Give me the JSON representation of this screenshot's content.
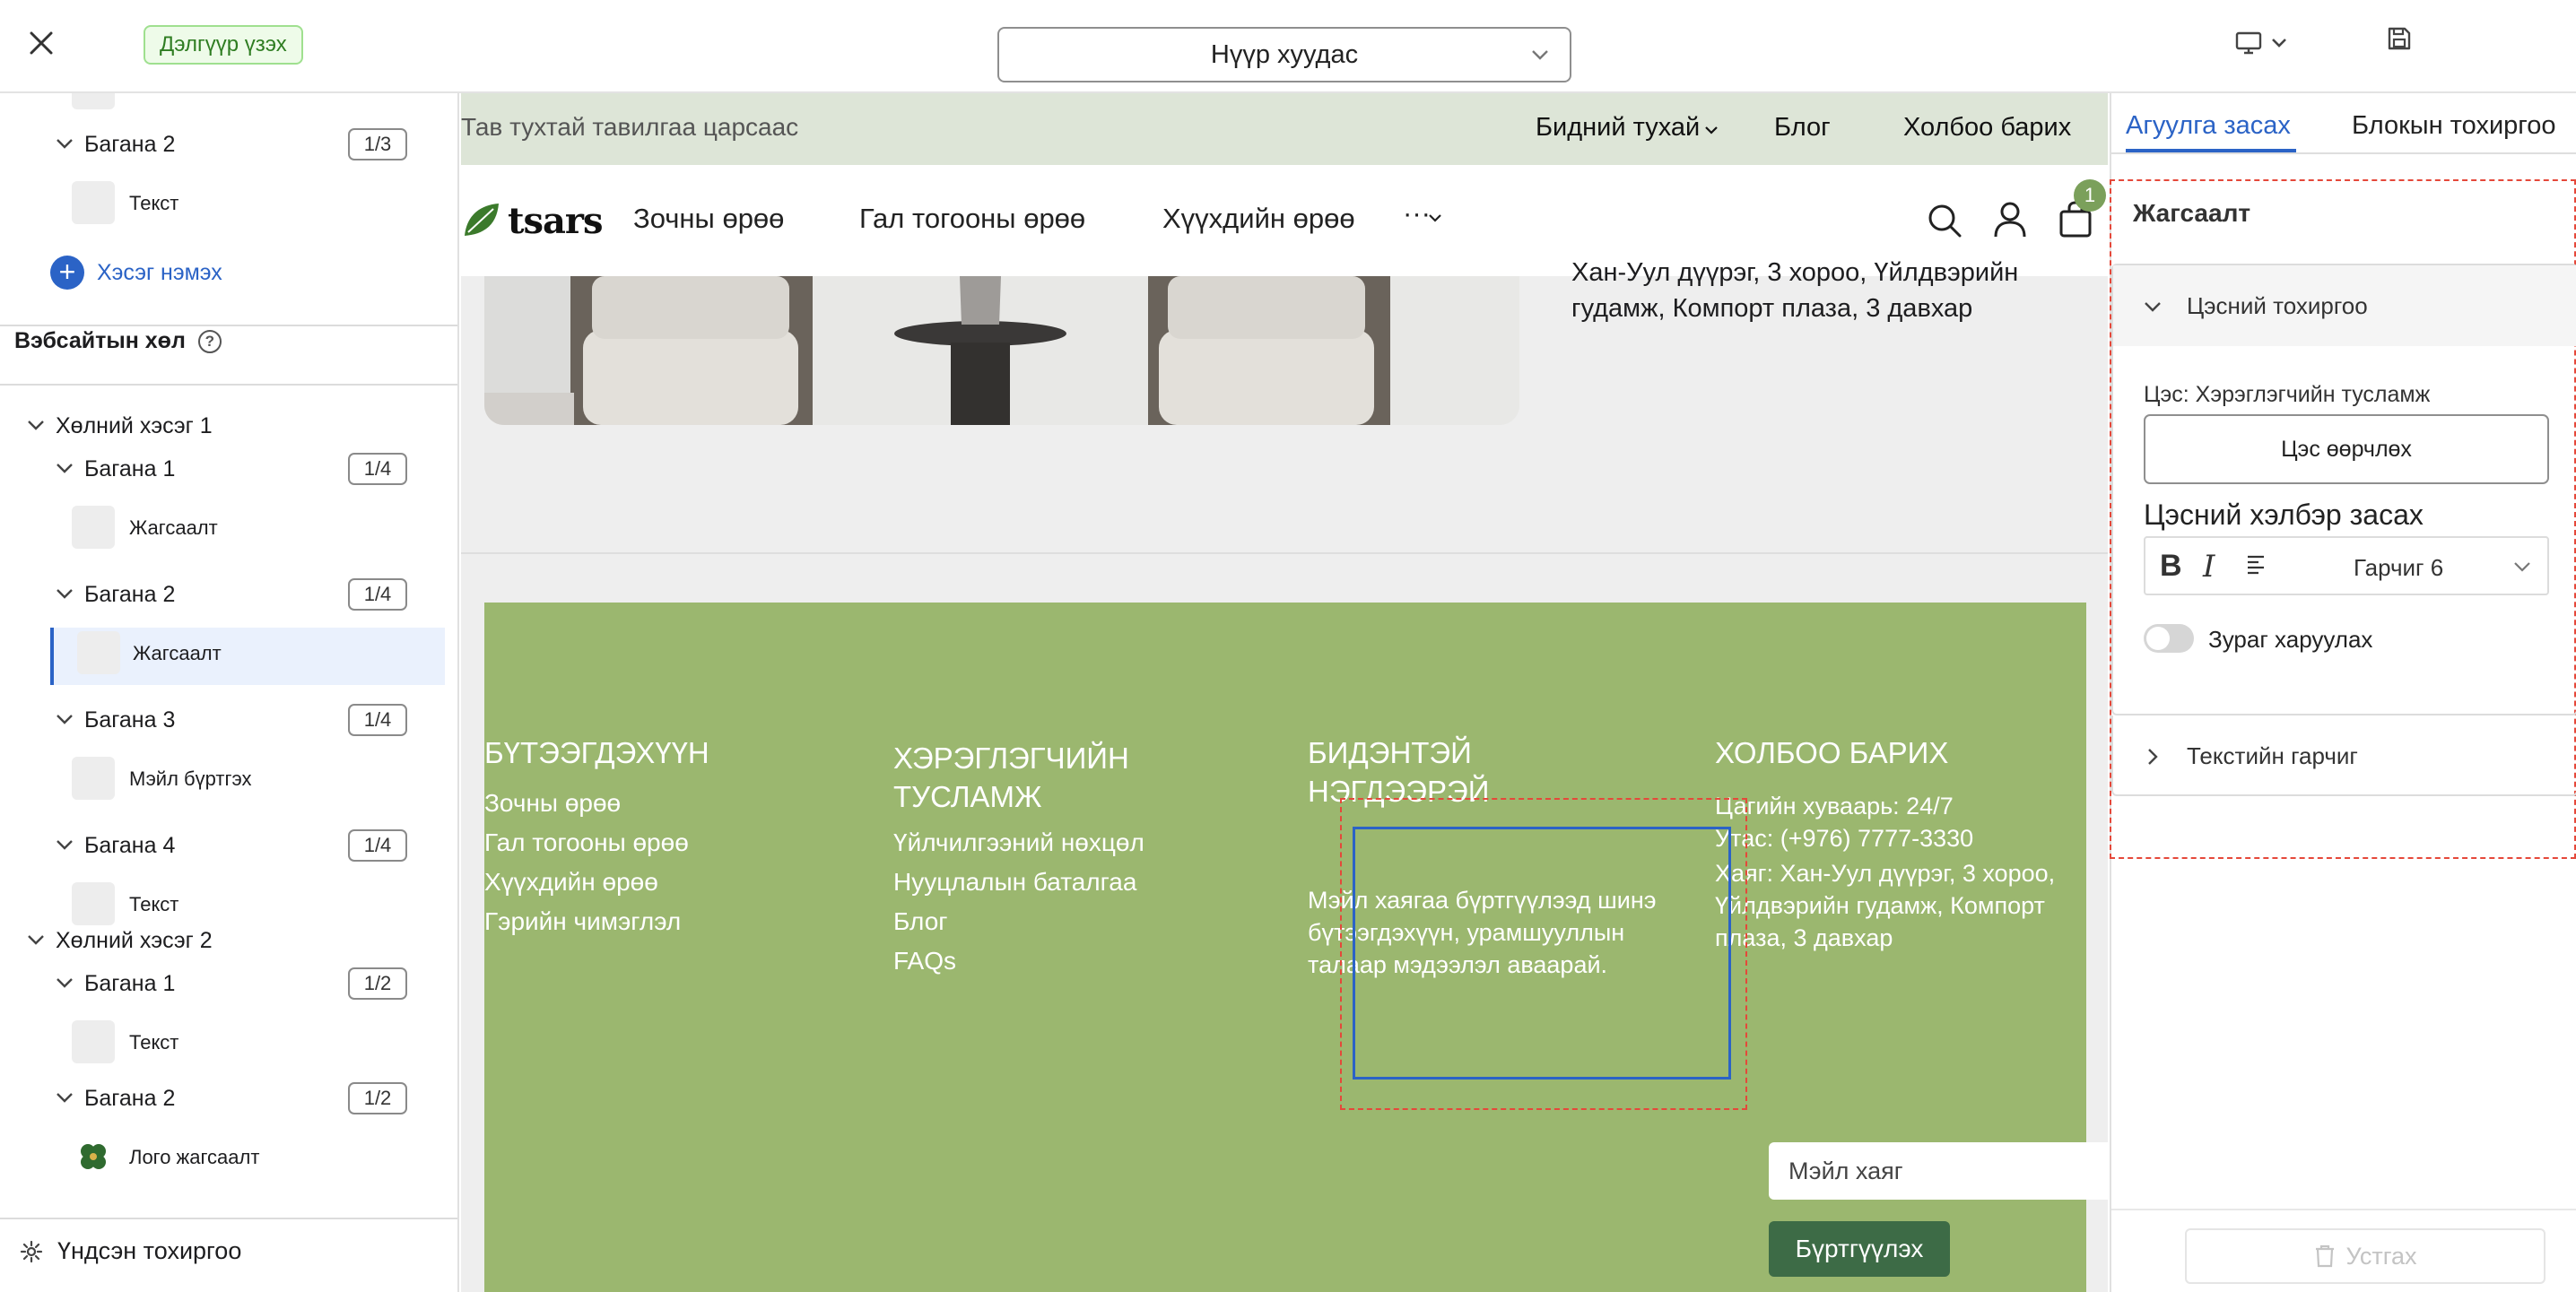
{
  "topbar": {
    "preview_label": "Дэлгүүр үзэх",
    "page_select_value": "Нүүр хуудас"
  },
  "left_panel": {
    "top_tree": {
      "column2_label": "Багана 2",
      "column2_count": "1/3",
      "text_leaf": "Текст",
      "add_section": "Хэсэг нэмэх"
    },
    "footer_heading": "Вэбсайтын хөл",
    "sections": [
      {
        "label": "Хөлний хэсэг 1"
      },
      {
        "label": "Хөлний хэсэг 2"
      }
    ],
    "columns": [
      {
        "label": "Багана 1",
        "count": "1/4",
        "leaf": "Жагсаалт"
      },
      {
        "label": "Багана 2",
        "count": "1/4",
        "leaf": "Жагсаалт"
      },
      {
        "label": "Багана 3",
        "count": "1/4",
        "leaf": "Мэйл бүртгэх"
      },
      {
        "label": "Багана 4",
        "count": "1/4",
        "leaf": "Текст"
      },
      {
        "label": "Багана 1",
        "count": "1/2",
        "leaf": "Текст"
      },
      {
        "label": "Багана 2",
        "count": "1/2",
        "leaf": "Лого жагсаалт"
      }
    ],
    "base_settings": "Үндсэн тохиргоо"
  },
  "canvas": {
    "announcement": "Тав тухтай тавилгаа царсаас",
    "announce_links": [
      "Бидний тухай",
      "Блог",
      "Холбоо барих"
    ],
    "logo_text": "tsars",
    "nav_items": [
      "Зочны өрөө",
      "Гал тогооны өрөө",
      "Хүүхдийн өрөө"
    ],
    "nav_more": "···",
    "cart_count": "1",
    "address_top": "Хан-Уул дүүрэг, 3 хороо, Үйлдвэрийн гудамж, Компорт плаза, 3 давхар",
    "footer": {
      "col1_title": "БҮТЭЭГДЭХҮҮН",
      "col1_links": [
        "Зочны өрөө",
        "Гал тогооны өрөө",
        "Хүүхдийн өрөө",
        "Гэрийн чимэглэл"
      ],
      "col2_title": "ХЭРЭГЛЭГЧИЙН ТУСЛАМЖ",
      "col2_links": [
        "Үйлчилгээний нөхцөл",
        "Нууцлалын баталгаа",
        "Блог",
        "FAQs"
      ],
      "col3_title": "БИДЭНТЭЙ НЭГДЭЭРЭЙ",
      "col3_text": "Мэйл хаягаа бүртгүүлээд шинэ бүтээгдэхүүн, урамшууллын талаар мэдээлэл аваарай.",
      "email_placeholder": "Мэйл хаяг",
      "subscribe": "Бүртгүүлэх",
      "col4_title": "ХОЛБОО БАРИХ",
      "col4_lines": [
        "Цагийн хуваарь: 24/7",
        "Утас: (+976) 7777-3330",
        "Хаяг: Хан-Уул дүүрэг, 3 хороо, Үйлдвэрийн гудамж, Компорт плаза, 3 давхар"
      ]
    }
  },
  "right_panel": {
    "tabs": [
      "Агуулга засах",
      "Блокын тохиргоо"
    ],
    "panel_title": "Жагсаалт",
    "menu_settings": "Цэсний тохиргоо",
    "menu_label": "Цэс: Хэрэглэгчийн тусламж",
    "change_menu": "Цэс өөрчлөх",
    "menu_style": "Цэсний хэлбэр засах",
    "heading_select": "Гарчиг 6",
    "show_image": "Зураг харуулах",
    "text_heading": "Текстийн гарчиг",
    "delete": "Устгах"
  },
  "colors": {
    "accent": "#2b63c6",
    "footer_bg": "#9bb76f",
    "button_green": "#3d6b46",
    "selection_dashed": "#e5483a"
  }
}
